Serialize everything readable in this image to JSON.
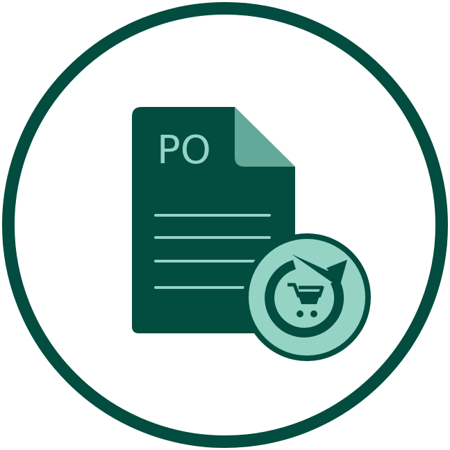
{
  "document": {
    "label": "PO"
  },
  "colors": {
    "dark_green": "#034c40",
    "light_teal": "#95d3c5",
    "fold_teal": "#62a999",
    "background": "#ffffff"
  },
  "icons": {
    "outer": "circle-outline-icon",
    "document": "document-icon",
    "badge": "refresh-cart-icon"
  }
}
